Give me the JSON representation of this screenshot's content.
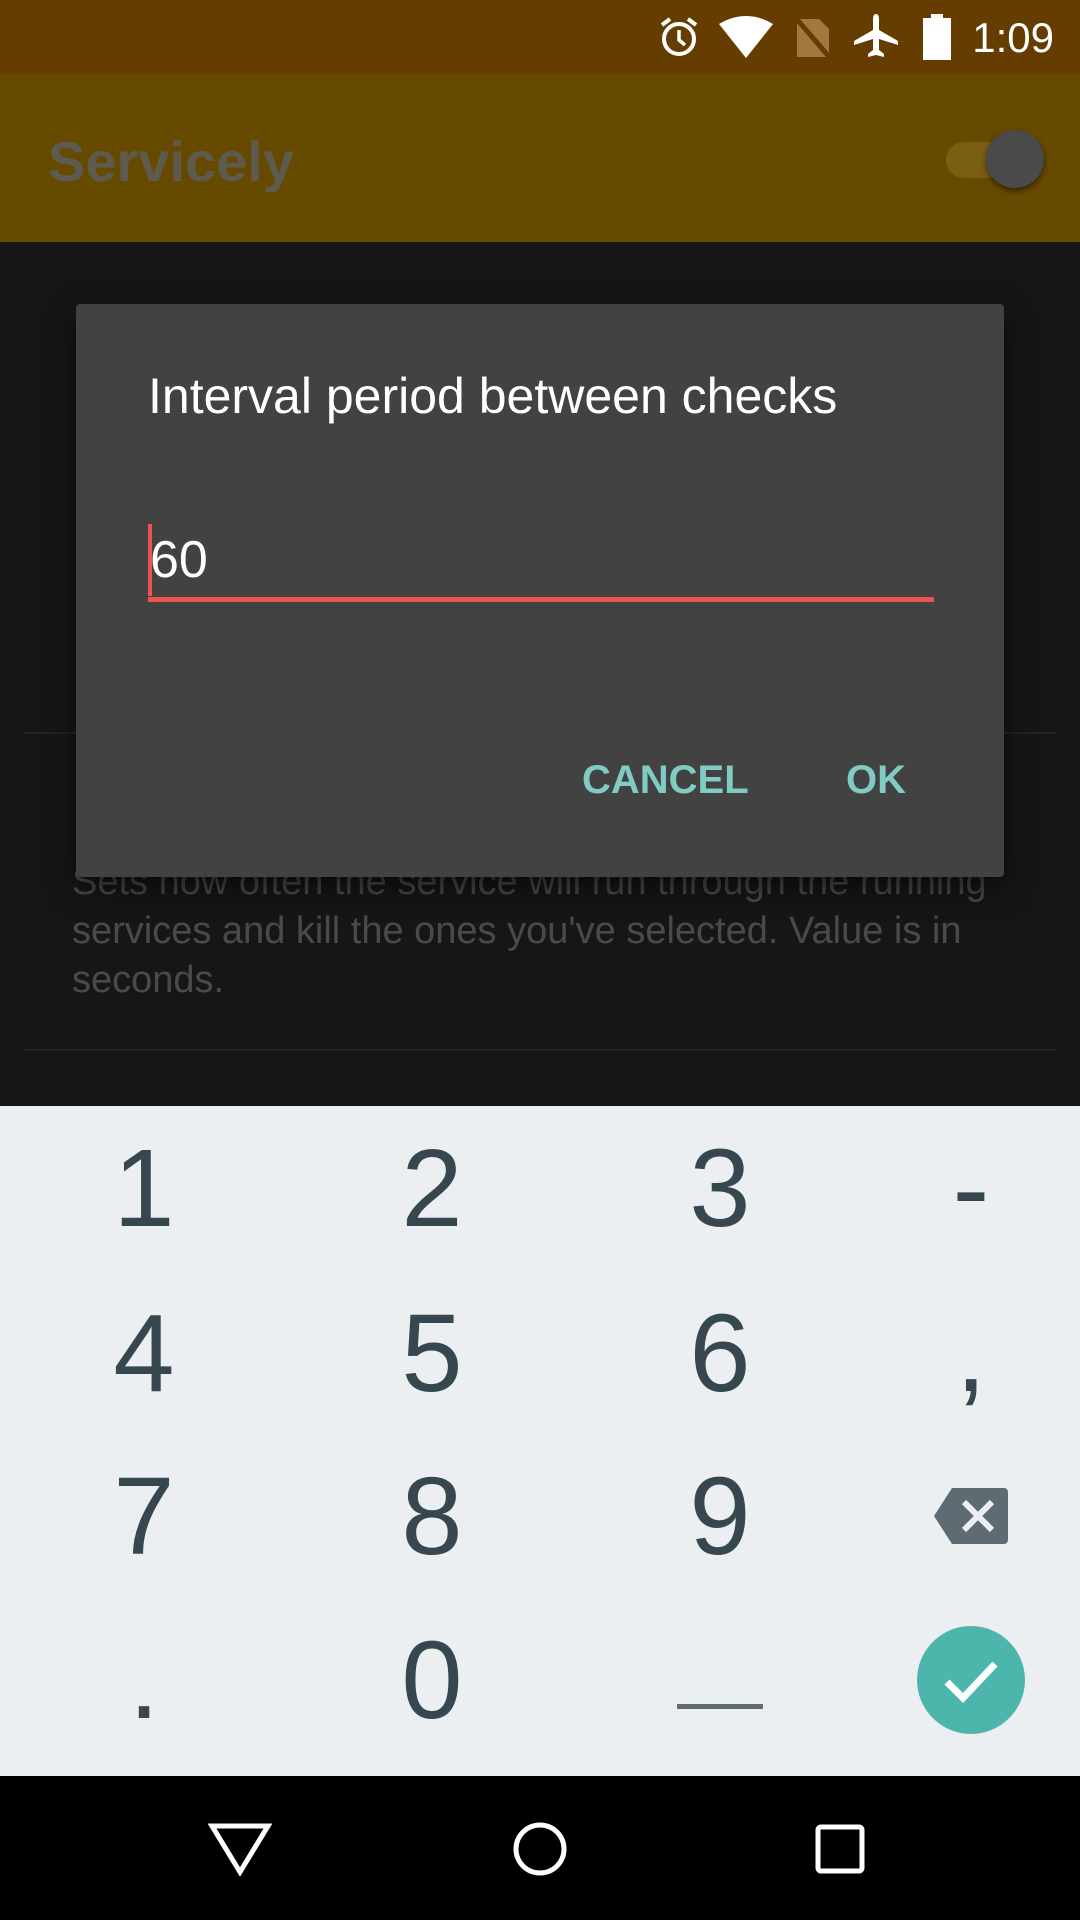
{
  "status_bar": {
    "time": "1:09",
    "icons": [
      "alarm-icon",
      "wifi-icon",
      "no-sim-icon",
      "airplane-mode-icon",
      "battery-icon"
    ]
  },
  "app_bar": {
    "title": "Servicely",
    "switch_on": true
  },
  "background": {
    "description_text": "Sets how often the service will run through the running services and kill the ones you've selected. Value is in seconds."
  },
  "dialog": {
    "title": "Interval period between checks",
    "input_value": "60",
    "cancel_label": "CANCEL",
    "ok_label": "OK"
  },
  "keyboard": {
    "rows": [
      [
        "1",
        "2",
        "3",
        "-"
      ],
      [
        "4",
        "5",
        "6",
        ","
      ],
      [
        "7",
        "8",
        "9",
        "backspace"
      ],
      [
        ".",
        "0",
        "_",
        "done"
      ]
    ]
  },
  "colors": {
    "accent": "#80cbc4",
    "input_underline": "#ef5350",
    "keyboard_bg": "#eceff1",
    "key_text": "#37474f",
    "done_button": "#4db6ac",
    "dialog_bg": "#424242"
  }
}
